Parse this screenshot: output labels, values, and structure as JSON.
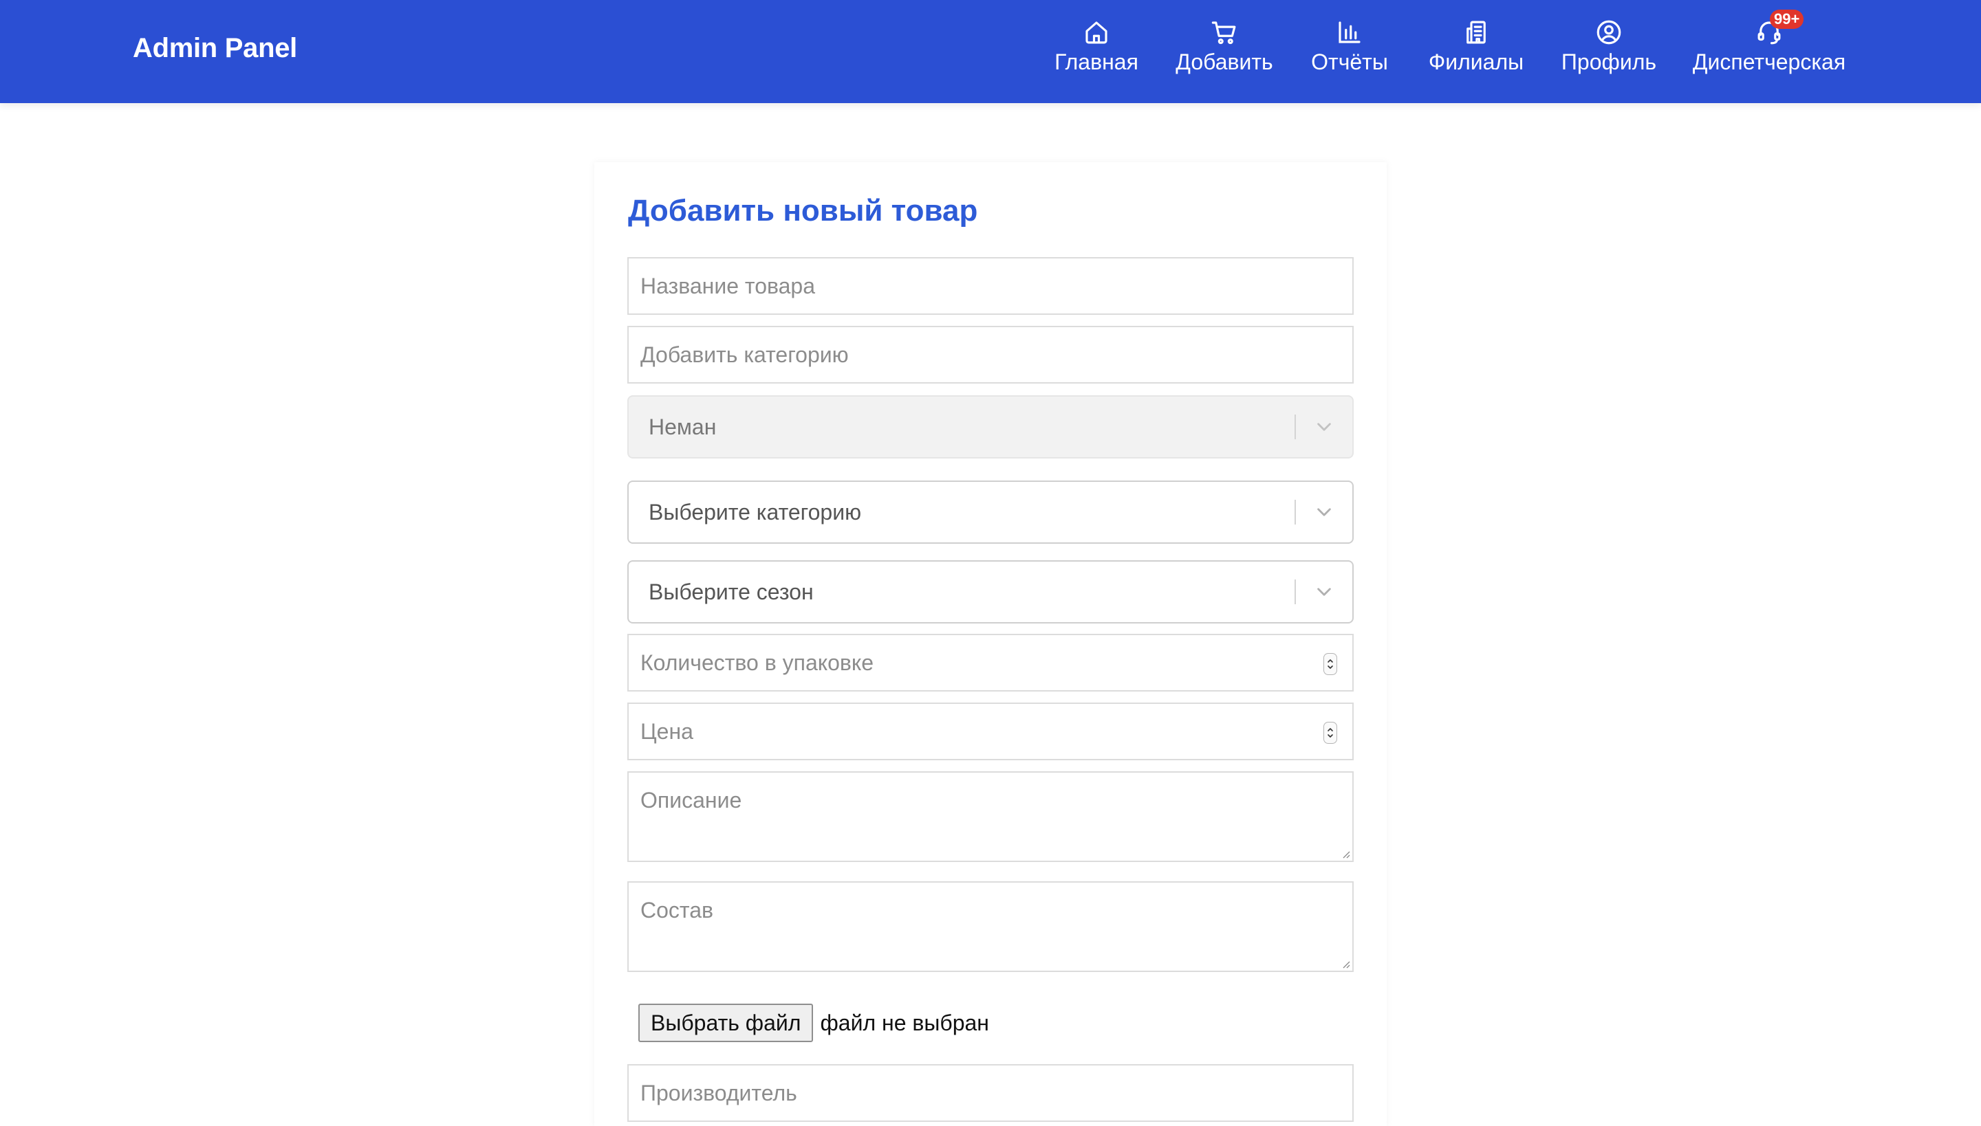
{
  "navbar": {
    "brand": "Admin Panel",
    "items": [
      {
        "label": "Главная",
        "icon": "home-icon"
      },
      {
        "label": "Добавить",
        "icon": "cart-icon"
      },
      {
        "label": "Отчёты",
        "icon": "bar-chart-icon"
      },
      {
        "label": "Филиалы",
        "icon": "building-icon"
      },
      {
        "label": "Профиль",
        "icon": "user-circle-icon"
      },
      {
        "label": "Диспетчерская",
        "icon": "headset-icon",
        "badge": "99+"
      }
    ],
    "color": "#2b4fd3",
    "badge_color": "#e0352b"
  },
  "form": {
    "title": "Добавить новый товар",
    "title_color": "#2d5bd7",
    "product_name_placeholder": "Название товара",
    "add_category_placeholder": "Добавить категорию",
    "brand_select_value": "Неман",
    "category_select_placeholder": "Выберите категорию",
    "season_select_placeholder": "Выберите сезон",
    "quantity_placeholder": "Количество в упаковке",
    "price_placeholder": "Цена",
    "description_placeholder": "Описание",
    "composition_placeholder": "Состав",
    "file_button_label": "Выбрать файл",
    "file_status": "файл не выбран",
    "manufacturer_placeholder": "Производитель"
  }
}
